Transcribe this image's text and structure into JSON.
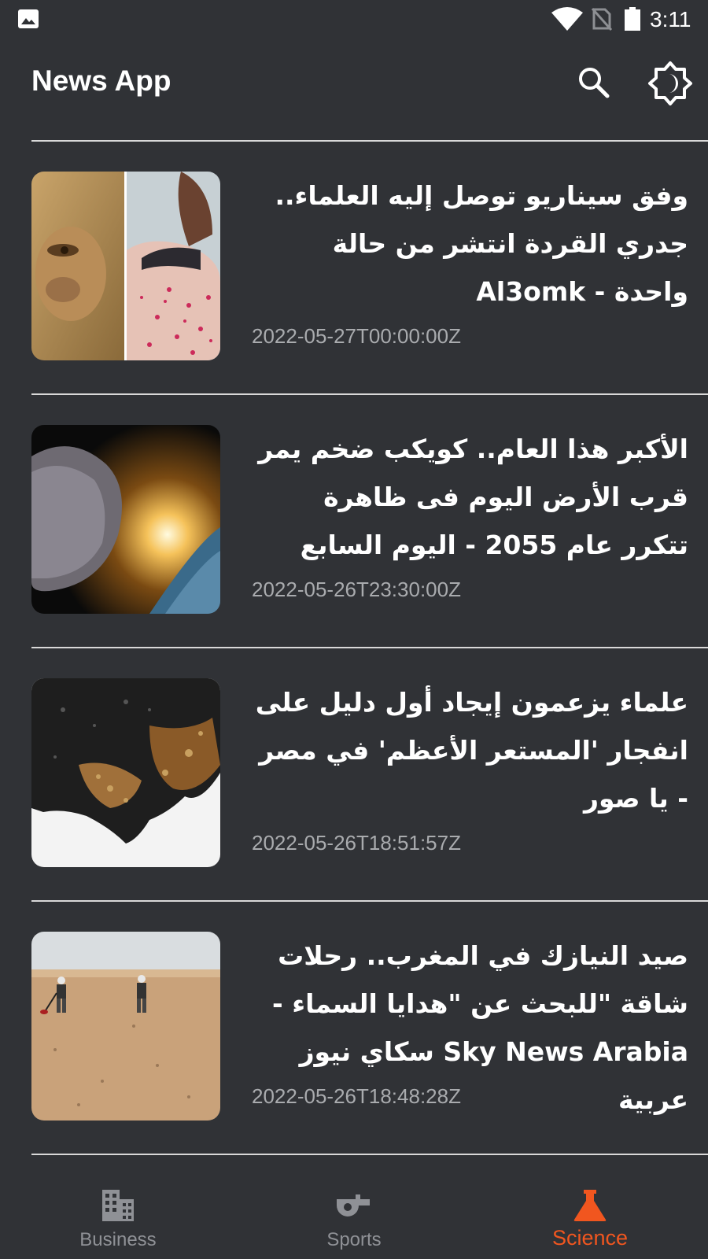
{
  "status_bar": {
    "time": "3:11",
    "icons": [
      "gallery-icon",
      "wifi-icon",
      "no-sim-icon",
      "battery-icon"
    ]
  },
  "app_bar": {
    "title": "News App",
    "actions": [
      "search-icon",
      "brightness-icon"
    ]
  },
  "articles": [
    {
      "title": "وفق سيناريو توصل إليه العلماء.. جدري القردة انتشر من حالة واحدة - Al3omk",
      "date": "2022-05-27T00:00:00Z"
    },
    {
      "title": "الأكبر هذا العام.. كويكب ضخم يمر قرب الأرض اليوم فى ظاهرة تتكرر عام 2055 - اليوم السابع",
      "date": "2022-05-26T23:30:00Z"
    },
    {
      "title": "علماء يزعمون إيجاد أول دليل على انفجار 'المستعر الأعظم' في مصر - يا صور",
      "date": "2022-05-26T18:51:57Z"
    },
    {
      "title": "صيد النيازك في المغرب.. رحلات شاقة \"للبحث عن \"هدايا السماء - Sky News Arabia سكاي نيوز عربية",
      "date": "2022-05-26T18:48:28Z"
    }
  ],
  "bottom_nav": {
    "items": [
      {
        "label": "Business",
        "icon": "building-icon"
      },
      {
        "label": "Sports",
        "icon": "whistle-icon"
      },
      {
        "label": "Science",
        "icon": "flask-icon"
      }
    ],
    "selected": "Science"
  },
  "colors": {
    "background": "#303236",
    "accent": "#f1561f",
    "divider": "#d9d9d9",
    "date_text": "#a9abae",
    "nav_inactive": "#8f9196"
  }
}
